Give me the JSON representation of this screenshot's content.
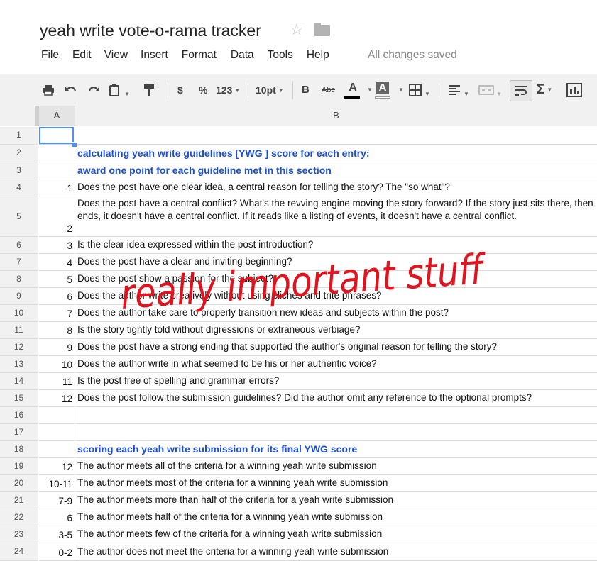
{
  "app": {
    "title": "yeah write vote-o-rama tracker",
    "save_status": "All changes saved"
  },
  "menu": [
    "File",
    "Edit",
    "View",
    "Insert",
    "Format",
    "Data",
    "Tools",
    "Help"
  ],
  "toolbar": {
    "currency": "$",
    "percent": "%",
    "more_formats": "123",
    "font_size": "10pt",
    "bold": "B",
    "strikethrough": "Abc",
    "text_color": "A",
    "fill_color": "A"
  },
  "columns": [
    "A",
    "B"
  ],
  "rows": [
    {
      "n": "1",
      "a": "",
      "b": ""
    },
    {
      "n": "2",
      "a": "",
      "b": "calculating yeah write guidelines [YWG ] score for each entry:",
      "style": "header"
    },
    {
      "n": "3",
      "a": "",
      "b": "award one point for each guideline met in this section",
      "style": "header"
    },
    {
      "n": "4",
      "a": "1",
      "b": "Does the post have one clear idea, a central reason for telling the story? The \"so what\"?"
    },
    {
      "n": "5",
      "a": "2",
      "b": "Does the post have a central conflict? What's the revving engine moving the story forward? If the story just sits there, then ends, it doesn't have a central conflict. If it reads like a listing of events, it doesn't have a central conflict."
    },
    {
      "n": "6",
      "a": "3",
      "b": "Is the clear idea expressed within the post introduction?"
    },
    {
      "n": "7",
      "a": "4",
      "b": "Does the post have a clear and inviting beginning?"
    },
    {
      "n": "8",
      "a": "5",
      "b": "Does the post show a passion for the subject?"
    },
    {
      "n": "9",
      "a": "6",
      "b": "Does the author write creatively without using cliches and trite phrases?"
    },
    {
      "n": "10",
      "a": "7",
      "b": "Does the author take care to properly transition new ideas and subjects within the post?"
    },
    {
      "n": "11",
      "a": "8",
      "b": "Is the story tightly told without digressions or extraneous verbiage?"
    },
    {
      "n": "12",
      "a": "9",
      "b": "Does the post have a strong ending that supported the author's original reason for telling the story?"
    },
    {
      "n": "13",
      "a": "10",
      "b": "Does the author write in what seemed to be his or her authentic voice?"
    },
    {
      "n": "14",
      "a": "11",
      "b": "Is the post free of spelling and grammar errors?"
    },
    {
      "n": "15",
      "a": "12",
      "b": "Does the post follow the submission guidelines? Did the author omit any reference to the optional prompts?"
    },
    {
      "n": "16",
      "a": "",
      "b": ""
    },
    {
      "n": "17",
      "a": "",
      "b": ""
    },
    {
      "n": "18",
      "a": "",
      "b": "scoring each yeah write submission for its final YWG score",
      "style": "header"
    },
    {
      "n": "19",
      "a": "12",
      "b": "The author meets all of the criteria for a winning yeah write submission"
    },
    {
      "n": "20",
      "a": "10-11",
      "b": "The author meets most of the criteria for a winning yeah write submission"
    },
    {
      "n": "21",
      "a": "7-9",
      "b": "The author meets more than half of the criteria for a yeah write submission"
    },
    {
      "n": "22",
      "a": "6",
      "b": "The author meets half of the criteria for a winning yeah write submission"
    },
    {
      "n": "23",
      "a": "3-5",
      "b": "The author meets few of the criteria for a winning yeah write submission"
    },
    {
      "n": "24",
      "a": "0-2",
      "b": "The author does not meet the criteria for a winning yeah write submission"
    }
  ],
  "annotation": {
    "text": "really important stuff",
    "color": "#e0141e"
  }
}
